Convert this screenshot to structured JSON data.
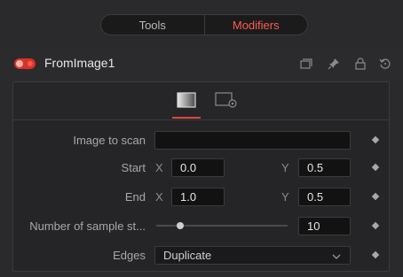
{
  "tabs": {
    "tools": "Tools",
    "modifiers": "Modifiers"
  },
  "header": {
    "tool_name": "FromImage1",
    "enabled": true,
    "icons": [
      "versions-icon",
      "pin-icon",
      "lock-icon",
      "reset-icon"
    ]
  },
  "subtabs": [
    {
      "icon": "controls-icon",
      "active": true
    },
    {
      "icon": "settings-icon",
      "active": false
    }
  ],
  "controls": {
    "image_to_scan": {
      "label": "Image to scan",
      "value": ""
    },
    "start": {
      "label": "Start",
      "x_label": "X",
      "x": "0.0",
      "y_label": "Y",
      "y": "0.5"
    },
    "end": {
      "label": "End",
      "x_label": "X",
      "x": "1.0",
      "y_label": "Y",
      "y": "0.5"
    },
    "samples": {
      "label": "Number of sample st...",
      "value": "10",
      "slider_level": 0.19
    },
    "edges": {
      "label": "Edges",
      "value": "Duplicate"
    }
  },
  "colors": {
    "accent": "#e0463c",
    "background": "#2a2a2c",
    "field": "#121213"
  }
}
